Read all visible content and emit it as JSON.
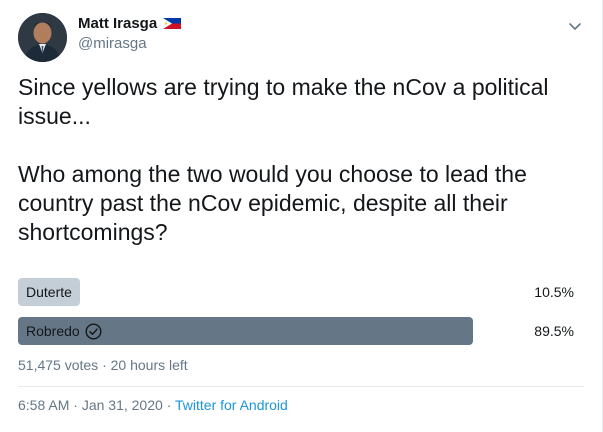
{
  "author": {
    "name": "Matt Irasga",
    "handle": "@mirasga",
    "flag_icon": "philippines-flag-icon"
  },
  "tweet": {
    "line1": "Since yellows are trying to make the nCov a political issue...",
    "line2": "Who among the two would you choose to lead the country past the nCov epidemic, despite all their shortcomings?"
  },
  "poll": {
    "options": [
      {
        "label": "Duterte",
        "percent_text": "10.5%",
        "percent": 10.5,
        "winner": false
      },
      {
        "label": "Robredo",
        "percent_text": "89.5%",
        "percent": 89.5,
        "winner": true
      }
    ],
    "votes": "51,475 votes",
    "time_left": "20 hours left",
    "separator": "·"
  },
  "footer": {
    "time": "6:58 AM",
    "date": "Jan 31, 2020",
    "source": "Twitter for Android",
    "separator": "·"
  },
  "colors": {
    "bar_default": "#c4ced6",
    "bar_winner": "#657786",
    "link": "#1b95e0",
    "secondary_text": "#657786"
  }
}
